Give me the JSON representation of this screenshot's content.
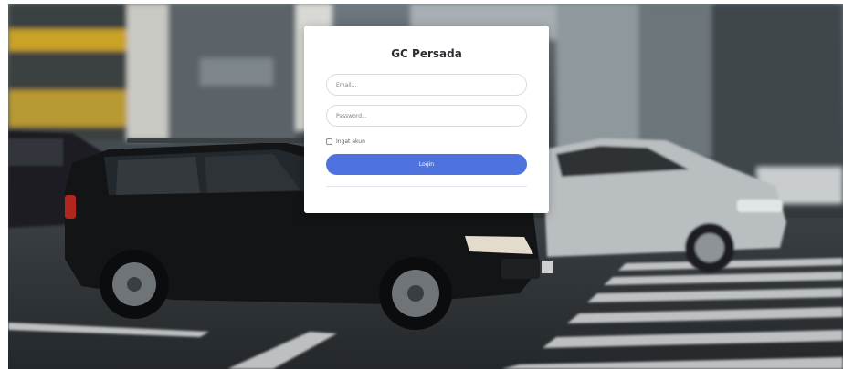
{
  "login": {
    "title": "GC Persada",
    "email_placeholder": "Email...",
    "password_placeholder": "Password...",
    "remember_label": "Ingat akun",
    "submit_label": "Login"
  },
  "colors": {
    "primary": "#4e73df",
    "card_background": "#ffffff",
    "title_text": "#2b2f33"
  }
}
